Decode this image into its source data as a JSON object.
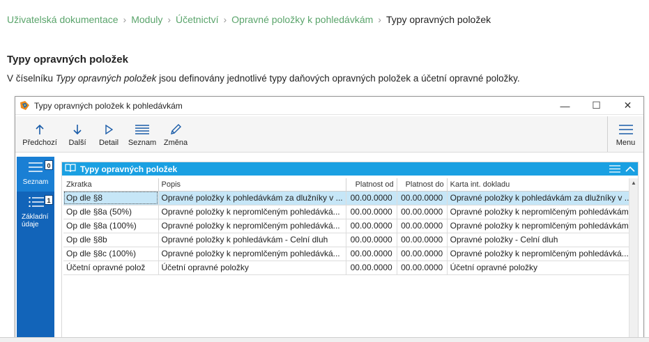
{
  "breadcrumb": [
    {
      "label": "Uživatelská dokumentace",
      "link": true
    },
    {
      "label": "Moduly",
      "link": true
    },
    {
      "label": "Účetnictví",
      "link": true
    },
    {
      "label": "Opravné položky k pohledávkám",
      "link": true
    },
    {
      "label": "Typy opravných položek",
      "link": false
    }
  ],
  "article": {
    "title": "Typy opravných položek",
    "intro_before": "V číselníku ",
    "intro_em": "Typy opravných položek",
    "intro_after": " jsou definovány jednotlivé typy daňových opravných položek a účetní opravné položky."
  },
  "window": {
    "title": "Typy opravných položek k pohledávkám",
    "controls": {
      "minimize": "—",
      "maximize": "☐",
      "close": "✕"
    }
  },
  "toolbar": {
    "buttons": [
      {
        "label": "Předchozí",
        "icon": "arrow-up-icon"
      },
      {
        "label": "Další",
        "icon": "arrow-down-icon"
      },
      {
        "label": "Detail",
        "icon": "play-icon"
      },
      {
        "label": "Seznam",
        "icon": "list-icon"
      },
      {
        "label": "Změna",
        "icon": "pencil-icon"
      }
    ],
    "menu_label": "Menu"
  },
  "sidenav": {
    "items": [
      {
        "label": "Seznam",
        "count": "0",
        "active": true
      },
      {
        "label": "Základní údaje",
        "count": "1",
        "active": false
      }
    ]
  },
  "panel": {
    "title": "Typy opravných položek"
  },
  "grid": {
    "columns": [
      "Zkratka",
      "Popis",
      "Platnost od",
      "Platnost do",
      "Karta int. dokladu"
    ],
    "rows": [
      [
        "Op dle §8",
        "Opravné položky k pohledávkám za dlužníky v ...",
        "00.00.0000",
        "00.00.0000",
        "Opravné položky k pohledávkám za dlužníky v ..."
      ],
      [
        "Op dle §8a (50%)",
        "Opravné položky k nepromlčeným pohledávká...",
        "00.00.0000",
        "00.00.0000",
        "Opravné položky k nepromlčeným pohledávkám"
      ],
      [
        "Op dle §8a (100%)",
        "Opravné položky k nepromlčeným pohledávká...",
        "00.00.0000",
        "00.00.0000",
        "Opravné položky k nepromlčeným pohledávkám"
      ],
      [
        "Op dle §8b",
        "Opravné položky k pohledávkám - Celní dluh",
        "00.00.0000",
        "00.00.0000",
        "Opravné položky - Celní dluh"
      ],
      [
        "Op dle §8c (100%)",
        "Opravné položky k nepromlčeným pohledávká...",
        "00.00.0000",
        "00.00.0000",
        "Opravné položky k nepromlčeným pohledávká..."
      ],
      [
        "Účetní opravné polož",
        "Účetní opravné položky",
        "00.00.0000",
        "00.00.0000",
        "Účetní opravné položky"
      ]
    ],
    "selected_row": 0
  },
  "colors": {
    "accent": "#1aa0e2",
    "sidenav": "#1264b9",
    "link": "#5aa46b",
    "selected_row": "#c6e6f7"
  }
}
